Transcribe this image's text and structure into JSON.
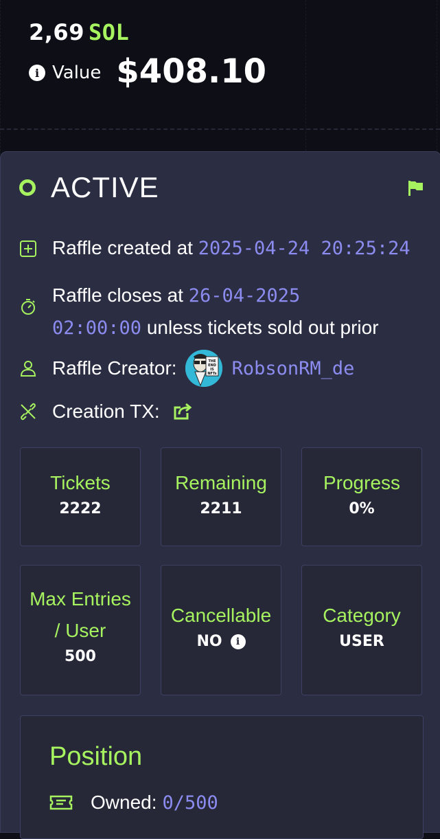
{
  "header": {
    "sol_amount": "2,69",
    "sol_currency": "SOL",
    "value_label": "Value",
    "value_amount": "$408.10"
  },
  "status": {
    "label": "ACTIVE",
    "color": "#a6f25f"
  },
  "info": {
    "created_prefix": "Raffle created at ",
    "created_at": "2025-04-24 20:25:24",
    "closes_prefix": "Raffle closes at ",
    "closes_date": "26-04-2025",
    "closes_time": "02:00:00",
    "closes_suffix": " unless tickets sold out prior",
    "creator_label": "Raffle Creator:",
    "creator_name": "RobsonRM_de",
    "creator_avatar_text": "THE END IS NFTs",
    "tx_label": "Creation TX:"
  },
  "stats": {
    "tickets_label": "Tickets",
    "tickets_value": "2222",
    "remaining_label": "Remaining",
    "remaining_value": "2211",
    "progress_label": "Progress",
    "progress_value": "0%",
    "max_entries_label": "Max Entries / User",
    "max_entries_value": "500",
    "cancellable_label": "Cancellable",
    "cancellable_value": "NO",
    "category_label": "Category",
    "category_value": "USER"
  },
  "position": {
    "title": "Position",
    "owned_label": "Owned:",
    "owned_value": "0/500"
  },
  "colors": {
    "accent": "#a6f25f",
    "link": "#8c8cf0",
    "card": "#2b2d42"
  }
}
